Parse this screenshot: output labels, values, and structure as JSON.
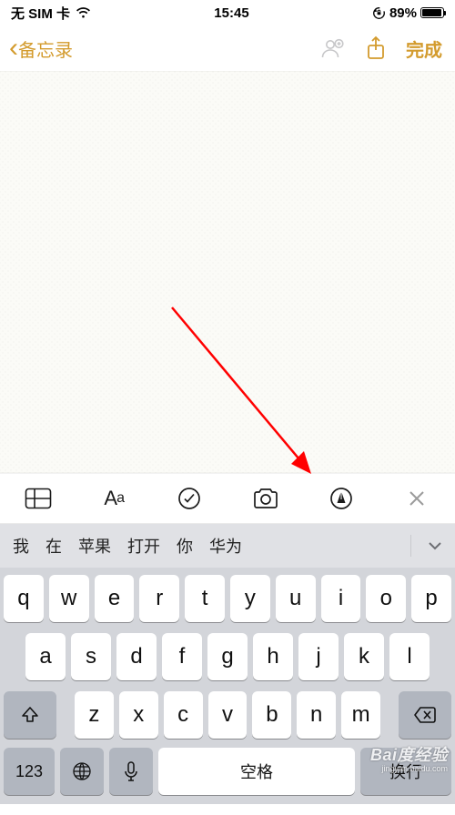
{
  "status": {
    "carrier": "无 SIM 卡",
    "time": "15:45",
    "battery_pct": "89%"
  },
  "nav": {
    "back_label": "备忘录",
    "done_label": "完成"
  },
  "toolbar": {
    "aa_label_big": "A",
    "aa_label_small": "a"
  },
  "suggestions": {
    "items": [
      "我",
      "在",
      "苹果",
      "打开",
      "你",
      "华为"
    ]
  },
  "keyboard": {
    "row1": [
      "q",
      "w",
      "e",
      "r",
      "t",
      "y",
      "u",
      "i",
      "o",
      "p"
    ],
    "row2": [
      "a",
      "s",
      "d",
      "f",
      "g",
      "h",
      "j",
      "k",
      "l"
    ],
    "row3": [
      "z",
      "x",
      "c",
      "v",
      "b",
      "n",
      "m"
    ],
    "num_label": "123",
    "space_label": "空格",
    "return_label": "换行"
  },
  "watermark": {
    "main": "Bai度经验",
    "sub": "jingyan.baidu.com"
  }
}
